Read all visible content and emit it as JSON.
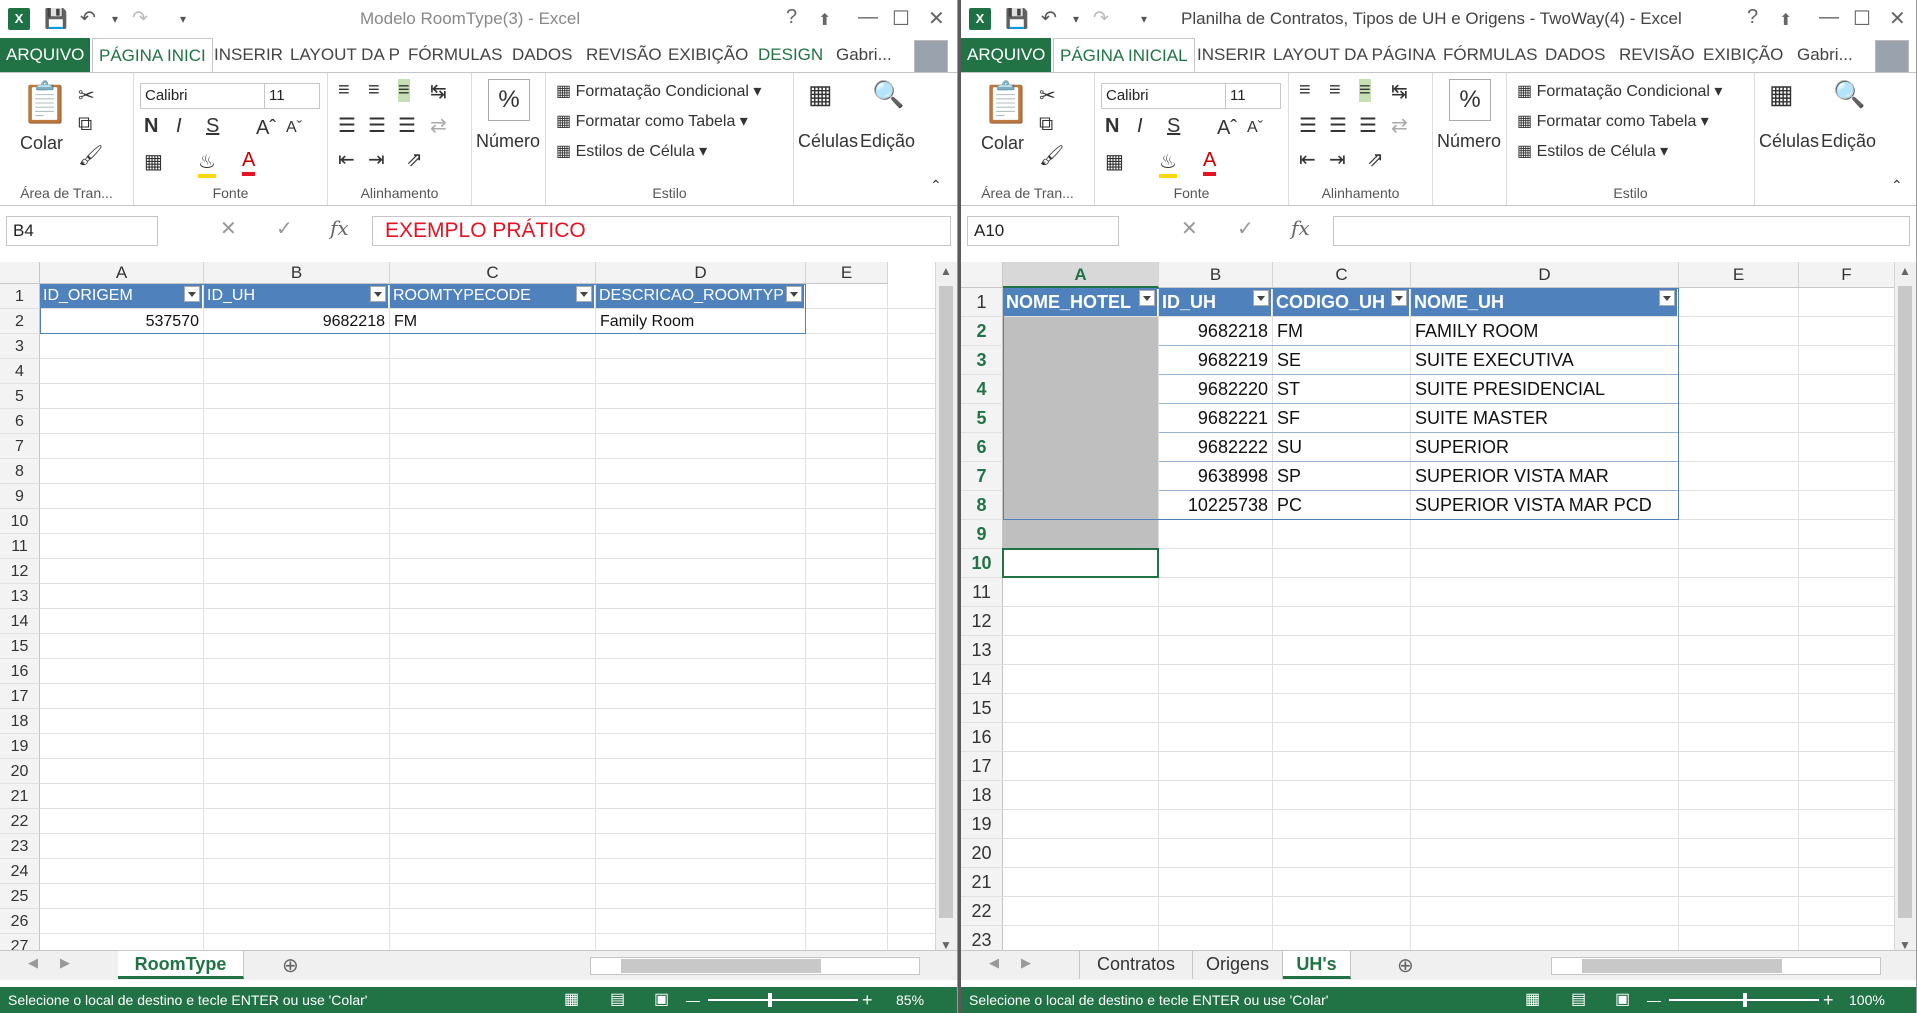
{
  "w1": {
    "title": "Modelo RoomType(3) - Excel",
    "tabs": [
      "ARQUIVO",
      "PÁGINA INICI",
      "INSERIR",
      "LAYOUT DA P",
      "FÓRMULAS",
      "DADOS",
      "REVISÃO",
      "EXIBIÇÃO",
      "DESIGN"
    ],
    "user": "Gabri...",
    "ribbon": {
      "paste": "Colar",
      "font_name": "Calibri",
      "font_size": "11",
      "numero": "Número",
      "cond_format": "Formatação Condicional",
      "format_table": "Formatar como Tabela",
      "cell_styles": "Estilos de Célula",
      "cells": "Células",
      "edit": "Edição",
      "groups": [
        "Área de Tran...",
        "Fonte",
        "Alinhamento",
        "Estilo"
      ]
    },
    "namebox": "B4",
    "formula": "EXEMPLO PRÁTICO",
    "columns": [
      "A",
      "B",
      "C",
      "D",
      "E"
    ],
    "rows": [
      "1",
      "2",
      "3",
      "4",
      "5",
      "6",
      "7",
      "8",
      "9",
      "10",
      "11",
      "12",
      "13",
      "14",
      "15",
      "16",
      "17",
      "18",
      "19",
      "20",
      "21",
      "22",
      "23",
      "24",
      "25",
      "26",
      "27"
    ],
    "headers": [
      "ID_ORIGEM",
      "ID_UH",
      "ROOMTYPECODE",
      "DESCRICAO_ROOMTYP"
    ],
    "data": [
      [
        "537570",
        "9682218",
        "FM",
        "Family Room"
      ]
    ],
    "sheet_tabs": [
      "RoomType"
    ],
    "status": "Selecione o local de destino e tecle ENTER ou use 'Colar'",
    "zoom": "85%"
  },
  "w2": {
    "title": "Planilha de Contratos, Tipos de UH e Origens - TwoWay(4) - Excel",
    "tabs": [
      "ARQUIVO",
      "PÁGINA INICIAL",
      "INSERIR",
      "LAYOUT DA PÁGINA",
      "FÓRMULAS",
      "DADOS",
      "REVISÃO",
      "EXIBIÇÃO"
    ],
    "user": "Gabri...",
    "ribbon": {
      "paste": "Colar",
      "font_name": "Calibri",
      "font_size": "11",
      "numero": "Número",
      "cond_format": "Formatação Condicional",
      "format_table": "Formatar como Tabela",
      "cell_styles": "Estilos de Célula",
      "cells": "Células",
      "edit": "Edição",
      "groups": [
        "Área de Tran...",
        "Fonte",
        "Alinhamento",
        "Estilo"
      ]
    },
    "namebox": "A10",
    "formula": "",
    "columns": [
      "A",
      "B",
      "C",
      "D",
      "E",
      "F"
    ],
    "rows": [
      "1",
      "2",
      "3",
      "4",
      "5",
      "6",
      "7",
      "8",
      "9",
      "10",
      "11",
      "12",
      "13",
      "14",
      "15",
      "16",
      "17",
      "18",
      "19",
      "20",
      "21",
      "22",
      "23"
    ],
    "headers": [
      "NOME_HOTEL",
      "ID_UH",
      "CODIGO_UH",
      "NOME_UH"
    ],
    "data": [
      [
        "",
        "9682218",
        "FM",
        "FAMILY ROOM"
      ],
      [
        "",
        "9682219",
        "SE",
        "SUITE EXECUTIVA"
      ],
      [
        "",
        "9682220",
        "ST",
        "SUITE PRESIDENCIAL"
      ],
      [
        "",
        "9682221",
        "SF",
        "SUITE MASTER"
      ],
      [
        "",
        "9682222",
        "SU",
        "SUPERIOR"
      ],
      [
        "",
        "9638998",
        "SP",
        "SUPERIOR VISTA MAR"
      ],
      [
        "",
        "10225738",
        "PC",
        "SUPERIOR VISTA MAR PCD"
      ]
    ],
    "sheet_tabs": [
      "Contratos",
      "Origens",
      "UH's"
    ],
    "status": "Selecione o local de destino e tecle ENTER ou use 'Colar'",
    "zoom": "100%"
  },
  "colors": {
    "excel_green": "#217346",
    "table_header": "#4f81bd",
    "formula_red": "#e81123"
  }
}
